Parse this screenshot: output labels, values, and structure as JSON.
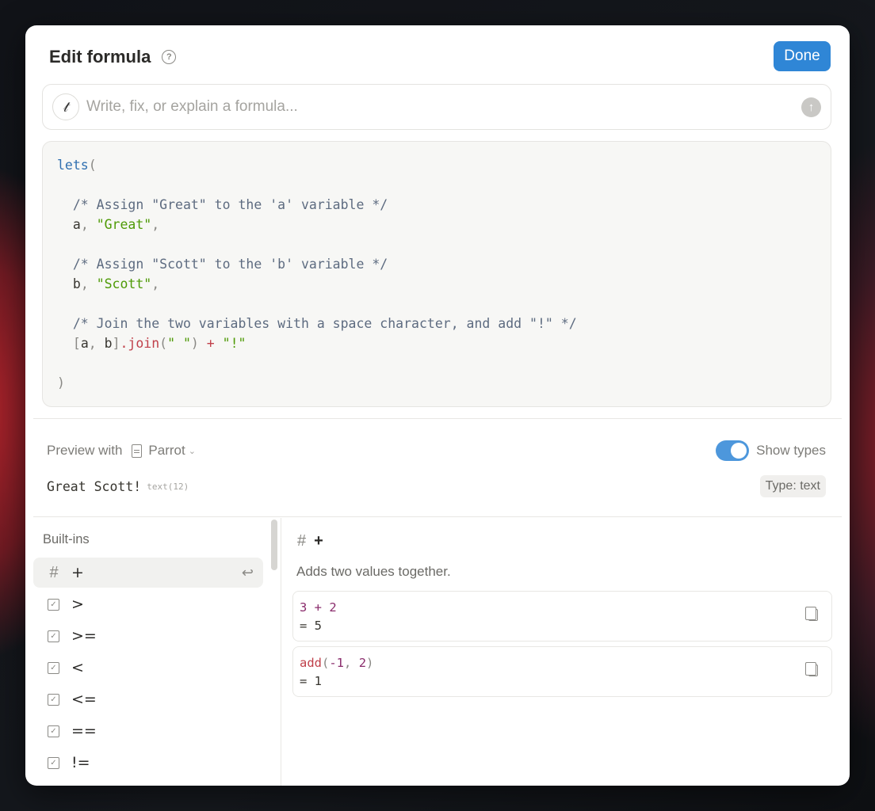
{
  "header": {
    "title": "Edit formula",
    "done_label": "Done"
  },
  "ai_bar": {
    "placeholder": "Write, fix, or explain a formula..."
  },
  "code": {
    "lines": [
      [
        {
          "t": "lets",
          "c": "kw"
        },
        {
          "t": "(",
          "c": "pun"
        }
      ],
      [],
      [
        {
          "t": "  /* Assign \"Great\" to the 'a' variable */",
          "c": "com"
        }
      ],
      [
        {
          "t": "  a",
          "c": ""
        },
        {
          "t": ", ",
          "c": "pun"
        },
        {
          "t": "\"Great\"",
          "c": "str"
        },
        {
          "t": ",",
          "c": "pun"
        }
      ],
      [],
      [
        {
          "t": "  /* Assign \"Scott\" to the 'b' variable */",
          "c": "com"
        }
      ],
      [
        {
          "t": "  b",
          "c": ""
        },
        {
          "t": ", ",
          "c": "pun"
        },
        {
          "t": "\"Scott\"",
          "c": "str"
        },
        {
          "t": ",",
          "c": "pun"
        }
      ],
      [],
      [
        {
          "t": "  /* Join the two variables with a space character, and add \"!\" */",
          "c": "com"
        }
      ],
      [
        {
          "t": "  [",
          "c": "pun"
        },
        {
          "t": "a",
          "c": ""
        },
        {
          "t": ", ",
          "c": "pun"
        },
        {
          "t": "b",
          "c": ""
        },
        {
          "t": "]",
          "c": "pun"
        },
        {
          "t": ".join",
          "c": "fn"
        },
        {
          "t": "(",
          "c": "pun"
        },
        {
          "t": "\" \"",
          "c": "str"
        },
        {
          "t": ") ",
          "c": "pun"
        },
        {
          "t": "+",
          "c": "fn"
        },
        {
          "t": " ",
          "c": ""
        },
        {
          "t": "\"!\"",
          "c": "str"
        }
      ],
      [],
      [
        {
          "t": ")",
          "c": "pun"
        }
      ]
    ]
  },
  "preview": {
    "label": "Preview with",
    "page_name": "Parrot",
    "show_types_label": "Show types",
    "show_types_on": true,
    "result_value": "Great Scott!",
    "result_type": "text(12)",
    "type_badge": "Type: text"
  },
  "sidebar": {
    "title": "Built-ins",
    "items": [
      {
        "label": "+",
        "icon": "hash-icon",
        "active": true
      },
      {
        "label": ">",
        "icon": "checkbox-icon",
        "active": false
      },
      {
        "label": ">=",
        "icon": "checkbox-icon",
        "active": false
      },
      {
        "label": "<",
        "icon": "checkbox-icon",
        "active": false
      },
      {
        "label": "<=",
        "icon": "checkbox-icon",
        "active": false
      },
      {
        "label": "==",
        "icon": "checkbox-icon",
        "active": false
      },
      {
        "label": "!=",
        "icon": "checkbox-icon",
        "active": false
      }
    ]
  },
  "detail": {
    "name": "+",
    "description": "Adds two values together.",
    "examples": [
      {
        "code": [
          {
            "t": "3",
            "c": "num"
          },
          {
            "t": " + ",
            "c": "op"
          },
          {
            "t": "2",
            "c": "num"
          }
        ],
        "result": "= 5"
      },
      {
        "code": [
          {
            "t": "add",
            "c": "fn"
          },
          {
            "t": "(",
            "c": "pun"
          },
          {
            "t": "-1",
            "c": "num"
          },
          {
            "t": ", ",
            "c": "pun"
          },
          {
            "t": "2",
            "c": "num"
          },
          {
            "t": ")",
            "c": "pun"
          }
        ],
        "result": "= 1"
      }
    ]
  },
  "colors": {
    "accent": "#2f86d6",
    "code_bg": "#f7f7f5",
    "string": "#4e9a06",
    "keyword": "#2f6fb0",
    "function": "#c0404a",
    "number": "#8a2c6c"
  }
}
